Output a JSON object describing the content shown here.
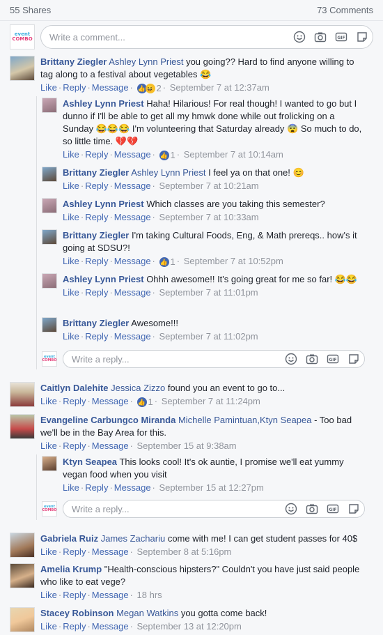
{
  "header": {
    "shares": "55 Shares",
    "comments": "73 Comments"
  },
  "composer": {
    "placeholder": "Write a comment..."
  },
  "reply_placeholder": "Write a reply...",
  "actions": {
    "like": "Like",
    "reply": "Reply",
    "message": "Message"
  },
  "logo": {
    "line1": "event",
    "line2": "COMBO"
  },
  "comments": [
    {
      "name": "Brittany Ziegler",
      "tag": "Ashley Lynn Priest",
      "text": "you going?? Hard to find anyone willing to tag along to a festival about vegetables 😂",
      "reactions": "2",
      "time": "September 7 at 12:37am"
    },
    {
      "name": "Ashley Lynn Priest",
      "tag": "",
      "text": "Haha! Hilarious! For real though! I wanted to go but I dunno if I'll be able to get all my hmwk done while out frolicking on a Sunday 😂😂😂 I'm volunteering that Saturday already 😨 So much to do, so little time. 💔💔",
      "reactions": "1",
      "time": "September 7 at 10:14am"
    },
    {
      "name": "Brittany Ziegler",
      "tag": "Ashley Lynn Priest",
      "text": "I feel ya on that one! 😊",
      "reactions": "",
      "time": "September 7 at 10:21am"
    },
    {
      "name": "Ashley Lynn Priest",
      "tag": "",
      "text": "Which classes are you taking this semester?",
      "reactions": "",
      "time": "September 7 at 10:33am"
    },
    {
      "name": "Brittany Ziegler",
      "tag": "",
      "text": "I'm taking Cultural Foods, Eng, & Math prereqs.. how's it going at SDSU?!",
      "reactions": "1",
      "time": "September 7 at 10:52pm"
    },
    {
      "name": "Ashley Lynn Priest",
      "tag": "",
      "text": "Ohhh awesome!! It's going great for me so far! 😂😂",
      "reactions": "",
      "time": "September 7 at 11:01pm"
    },
    {
      "name": "Brittany Ziegler",
      "tag": "",
      "text": "Awesome!!!",
      "reactions": "",
      "time": "September 7 at 11:02pm"
    },
    {
      "name": "Caitlyn Dalehite",
      "tag": "Jessica Zizzo",
      "text": "found you an event to go to...",
      "reactions": "1",
      "time": "September 7 at 11:24pm"
    },
    {
      "name": "Evangeline Carbungco Miranda",
      "tag": "Michelle Pamintuan,Ktyn Seapea",
      "text": "- Too bad we'll be in the Bay Area for this.",
      "reactions": "",
      "time": "September 15 at 9:38am"
    },
    {
      "name": "Ktyn Seapea",
      "tag": "",
      "text": "This looks cool! It's ok auntie, I promise we'll eat yummy vegan food when you visit",
      "reactions": "",
      "time": "September 15 at 12:27pm"
    },
    {
      "name": "Gabriela Ruiz",
      "tag": "James Zachariu",
      "text": "come with me! I can get student passes for 40$",
      "reactions": "",
      "time": "September 8 at 5:16pm"
    },
    {
      "name": "Amelia Krump",
      "tag": "",
      "text": "\"Health-conscious hipsters?\" Couldn't you have just said people who like to eat vege?",
      "reactions": "",
      "time": "18 hrs"
    },
    {
      "name": "Stacey Robinson",
      "tag": "Megan Watkins",
      "text": "you gotta come back!",
      "reactions": "",
      "time": "September 13 at 12:20pm"
    }
  ],
  "colors": {
    "link": "#385898",
    "action": "#4267b2",
    "meta": "#90949c",
    "bg": "#f6f7f9"
  }
}
